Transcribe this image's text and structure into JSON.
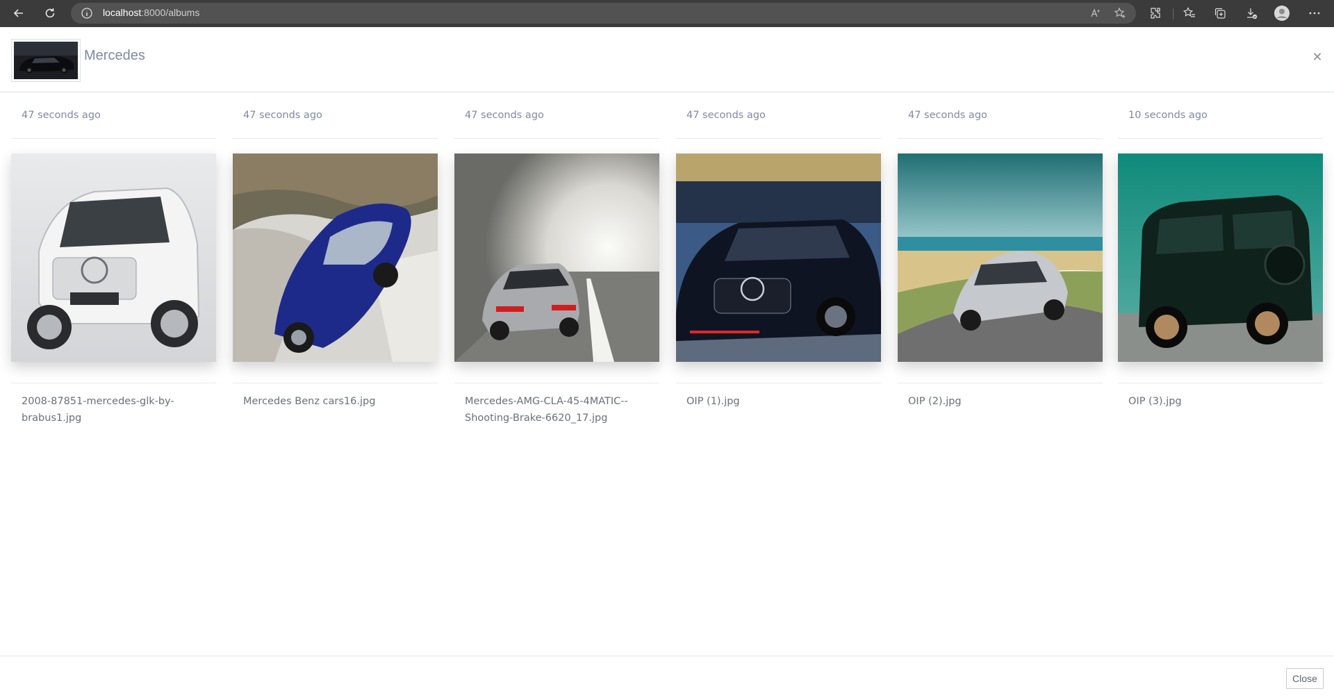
{
  "browser": {
    "url_host": "localhost",
    "url_rest": ":8000/albums"
  },
  "album": {
    "title": "Mercedes"
  },
  "photos": [
    {
      "time": "47 seconds ago",
      "name": "2008-87851-mercedes-glk-by-brabus1.jpg",
      "image": "white-suv-photo"
    },
    {
      "time": "47 seconds ago",
      "name": "Mercedes Benz cars16.jpg",
      "image": "blue-coupe-photo"
    },
    {
      "time": "47 seconds ago",
      "name": "Mercedes-AMG-CLA-45-4MATIC--Shooting-Brake-6620_17.jpg",
      "image": "silver-wagon-tunnel-photo"
    },
    {
      "time": "47 seconds ago",
      "name": "OIP (1).jpg",
      "image": "black-sedan-photo"
    },
    {
      "time": "47 seconds ago",
      "name": "OIP (2).jpg",
      "image": "silver-sedan-coast-photo"
    },
    {
      "time": "10 seconds ago",
      "name": "OIP (3).jpg",
      "image": "green-gwagon-photo"
    }
  ],
  "footer": {
    "close_label": "Close"
  }
}
